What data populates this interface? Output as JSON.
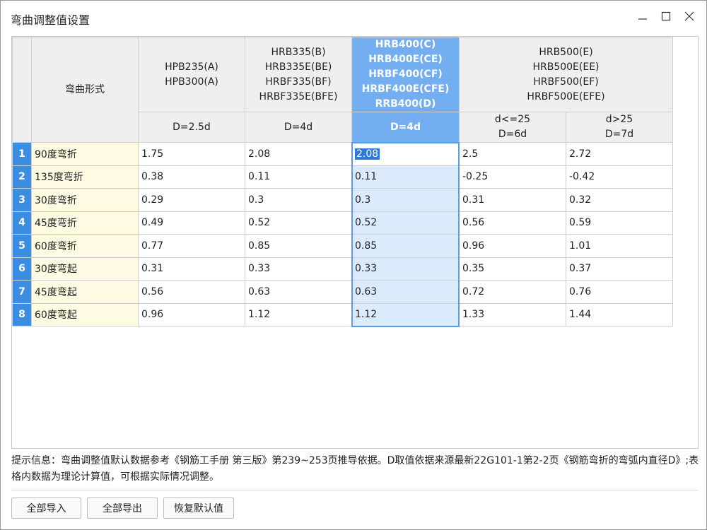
{
  "window": {
    "title": "弯曲调整值设置"
  },
  "table": {
    "header": {
      "shape_col": "弯曲形式",
      "groups": [
        {
          "label": "HPB235(A)\nHPB300(A)"
        },
        {
          "label": "HRB335(B)\nHRB335E(BE)\nHRBF335(BF)\nHRBF335E(BFE)"
        },
        {
          "label": "HRB400(C)\nHRB400E(CE)\nHRBF400(CF)\nHRBF400E(CFE)\nRRB400(D)"
        },
        {
          "label": "HRB500(E)\nHRB500E(EE)\nHRBF500(EF)\nHRBF500E(EFE)"
        }
      ],
      "sub": [
        "D=2.5d",
        "D=4d",
        "D=4d",
        "d<=25\nD=6d",
        "d>25\nD=7d"
      ]
    },
    "rows": [
      {
        "num": "1",
        "name": "90度弯折",
        "values": [
          "1.75",
          "2.08",
          "2.08",
          "2.5",
          "2.72"
        ]
      },
      {
        "num": "2",
        "name": "135度弯折",
        "values": [
          "0.38",
          "0.11",
          "0.11",
          "-0.25",
          "-0.42"
        ]
      },
      {
        "num": "3",
        "name": "30度弯折",
        "values": [
          "0.29",
          "0.3",
          "0.3",
          "0.31",
          "0.32"
        ]
      },
      {
        "num": "4",
        "name": "45度弯折",
        "values": [
          "0.49",
          "0.52",
          "0.52",
          "0.56",
          "0.59"
        ]
      },
      {
        "num": "5",
        "name": "60度弯折",
        "values": [
          "0.77",
          "0.85",
          "0.85",
          "0.96",
          "1.01"
        ]
      },
      {
        "num": "6",
        "name": "30度弯起",
        "values": [
          "0.31",
          "0.33",
          "0.33",
          "0.35",
          "0.37"
        ]
      },
      {
        "num": "7",
        "name": "45度弯起",
        "values": [
          "0.56",
          "0.63",
          "0.63",
          "0.72",
          "0.76"
        ]
      },
      {
        "num": "8",
        "name": "60度弯起",
        "values": [
          "0.96",
          "1.12",
          "1.12",
          "1.33",
          "1.44"
        ]
      }
    ]
  },
  "hint": "提示信息：弯曲调整值默认数据参考《钢筋工手册 第三版》第239~253页推导依据。D取值依据来源最新22G101-1第2-2页《钢筋弯折的弯弧内直径D》;表格内数据为理论计算值，可根据实际情况调整。",
  "buttons": {
    "import": "全部导入",
    "export": "全部导出",
    "restore": "恢复默认值"
  },
  "colors": {
    "selected_header": "#72aef0",
    "row_number": "#3b8de2",
    "name_cell": "#fffbe3",
    "selected_column": "#dcebfb"
  }
}
